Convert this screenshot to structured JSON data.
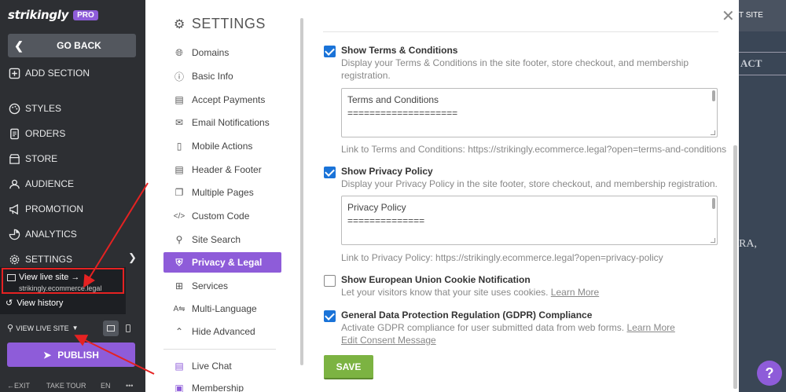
{
  "sidebar": {
    "brand": "strikingly",
    "badge": "PRO",
    "go_back": "GO BACK",
    "add_section": "ADD SECTION",
    "items": [
      {
        "label": "STYLES",
        "icon": "palette-icon"
      },
      {
        "label": "ORDERS",
        "icon": "orders-icon"
      },
      {
        "label": "STORE",
        "icon": "store-icon"
      },
      {
        "label": "AUDIENCE",
        "icon": "audience-icon"
      },
      {
        "label": "PROMOTION",
        "icon": "megaphone-icon"
      },
      {
        "label": "ANALYTICS",
        "icon": "analytics-icon"
      },
      {
        "label": "SETTINGS",
        "icon": "gear-icon"
      }
    ],
    "popup": {
      "live_site": "View live site →",
      "live_url": "strikingly.ecommerce.legal",
      "history": "View history"
    },
    "view_live": "VIEW LIVE SITE",
    "publish": "PUBLISH",
    "bottom": {
      "exit": "EXIT",
      "tour": "TAKE TOUR",
      "lang": "EN",
      "more": "•••"
    }
  },
  "nav": {
    "title": "SETTINGS",
    "items": [
      {
        "label": "Domains",
        "icon": "globe-icon"
      },
      {
        "label": "Basic Info",
        "icon": "info-icon"
      },
      {
        "label": "Accept Payments",
        "icon": "payment-icon"
      },
      {
        "label": "Email Notifications",
        "icon": "email-icon"
      },
      {
        "label": "Mobile Actions",
        "icon": "mobile-icon"
      },
      {
        "label": "Header & Footer",
        "icon": "header-footer-icon"
      },
      {
        "label": "Multiple Pages",
        "icon": "pages-icon"
      },
      {
        "label": "Custom Code",
        "icon": "code-icon"
      },
      {
        "label": "Site Search",
        "icon": "search-icon"
      },
      {
        "label": "Privacy & Legal",
        "icon": "shield-icon"
      },
      {
        "label": "Services",
        "icon": "grid-icon"
      },
      {
        "label": "Multi-Language",
        "icon": "language-icon"
      },
      {
        "label": "Hide Advanced",
        "icon": "chevron-up-icon"
      },
      {
        "label": "Live Chat",
        "icon": "chat-icon"
      },
      {
        "label": "Membership",
        "icon": "membership-icon"
      }
    ],
    "active": "Privacy & Legal"
  },
  "content": {
    "terms": {
      "checked": true,
      "title": "Show Terms & Conditions",
      "desc": "Display your Terms & Conditions in the site footer, store checkout, and membership registration.",
      "textarea_line1": "Terms and Conditions",
      "textarea_line2": "====================",
      "link": "Link to Terms and Conditions: https://strikingly.ecommerce.legal?open=terms-and-conditions"
    },
    "privacy": {
      "checked": true,
      "title": "Show Privacy Policy",
      "desc": "Display your Privacy Policy in the site footer, store checkout, and membership registration.",
      "textarea_line1": "Privacy Policy",
      "textarea_line2": "==============",
      "link": "Link to Privacy Policy: https://strikingly.ecommerce.legal?open=privacy-policy"
    },
    "cookie": {
      "checked": false,
      "title": "Show European Union Cookie Notification",
      "desc": "Let your visitors know that your site uses cookies.",
      "learn_more": "Learn More"
    },
    "gdpr": {
      "checked": true,
      "title": "General Data Protection Regulation (GDPR) Compliance",
      "desc": "Activate GDPR compliance for user submitted data from web forms.",
      "learn_more": "Learn More",
      "edit_consent": "Edit Consent Message"
    },
    "save": "SAVE"
  },
  "preview": {
    "site_label": "T SITE",
    "contact_label": "ACT",
    "ra_text": "RA,"
  },
  "help": "?",
  "colors": {
    "accent_purple": "#8e5cd9",
    "save_green": "#7cb342",
    "checkbox_blue": "#1a73d8",
    "annotation_red": "#e52222"
  }
}
